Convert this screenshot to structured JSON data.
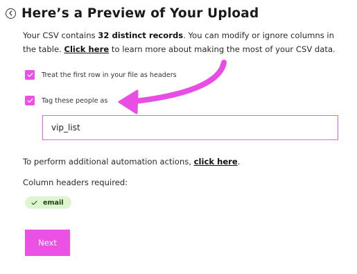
{
  "header": {
    "title": "Here’s a Preview of Your Upload"
  },
  "description": {
    "prefix": "Your CSV contains ",
    "records": "32 distinct records",
    "middle": ". You can modify or ignore columns in the table. ",
    "link": "Click here",
    "suffix": " to learn more about making the most of your CSV data."
  },
  "options": {
    "first_row_label": "Treat the first row in your file as headers",
    "first_row_checked": true,
    "tag_label": "Tag these people as",
    "tag_checked": true,
    "tag_value": "vip_list"
  },
  "automation": {
    "prefix": "To perform additional automation actions, ",
    "link": "click here",
    "suffix": "."
  },
  "required": {
    "label": "Column headers required:",
    "columns": [
      "email"
    ]
  },
  "actions": {
    "next_label": "Next"
  },
  "colors": {
    "accent": "#ec51e6",
    "pill_bg": "#ddf6cf",
    "annotation_arrow": "#e84ee3"
  }
}
